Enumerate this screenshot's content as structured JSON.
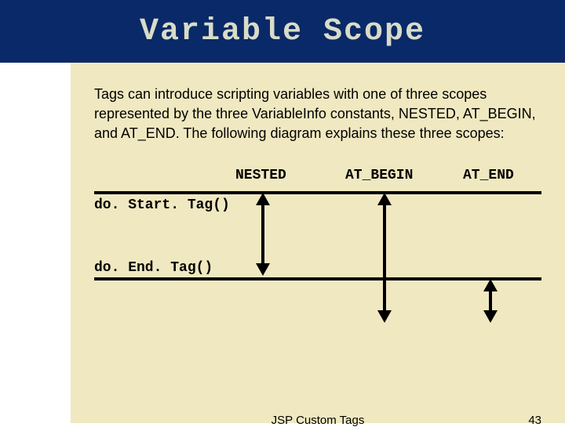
{
  "title": "Variable Scope",
  "description": "Tags can introduce scripting variables with one of three scopes represented by the three VariableInfo constants, NESTED, AT_BEGIN, and AT_END. The following diagram explains these three scopes:",
  "columns": {
    "nested": "NESTED",
    "at_begin": "AT_BEGIN",
    "at_end": "AT_END"
  },
  "rows": {
    "start": "do. Start. Tag()",
    "end": "do. End. Tag()"
  },
  "footer": {
    "text": "JSP Custom Tags",
    "page": "43"
  },
  "chart_data": {
    "type": "table",
    "title": "Variable Scope lifetimes relative to tag lifecycle",
    "rows_axis": [
      "doStartTag()",
      "doEndTag()"
    ],
    "scopes": [
      {
        "name": "NESTED",
        "from": "doStartTag()",
        "to": "doEndTag()",
        "extends_after_end": false
      },
      {
        "name": "AT_BEGIN",
        "from": "doStartTag()",
        "to": "after doEndTag()",
        "extends_after_end": true
      },
      {
        "name": "AT_END",
        "from": "doEndTag()",
        "to": "after doEndTag()",
        "extends_after_end": true
      }
    ]
  }
}
